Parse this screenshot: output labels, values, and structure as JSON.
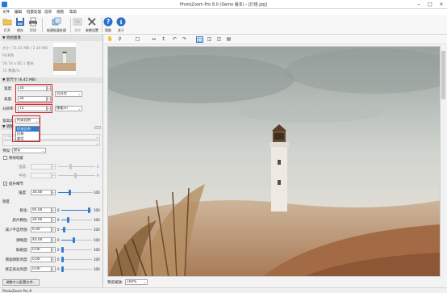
{
  "window": {
    "title": "PhotoZoom Pro 8.0 (Demo 版本) - [灯塔.jpg]"
  },
  "menu": [
    "文件",
    "编辑",
    "批量处理",
    "选项",
    "视图",
    "帮助"
  ],
  "toolbar": {
    "open": "打开",
    "save": "保存",
    "print": "打印",
    "batch": "新建批量处理",
    "preview": "预览",
    "params": "参数设置",
    "help": "帮助",
    "about": "关于"
  },
  "source": {
    "header": "原始图像",
    "size": "大小: 71.61 MB / 2.16 MB",
    "color": "RGB色",
    "dims": "56.74 x 85.1 厘米",
    "res": "72 像素/in"
  },
  "newsize": {
    "header": "新尺寸 (6.45 MB)",
    "width_label": "宽度:",
    "width_value": "30",
    "height_label": "高度:",
    "height_value": "30",
    "unit": "百分比",
    "res_label": "分辨率:",
    "res_value": "72",
    "res_unit": "像素/in",
    "fit_label": "宽高比:",
    "fit_value": "约束比例",
    "fit_options": [
      "约束比例",
      "拉伸",
      "裁切"
    ]
  },
  "adjust": {
    "header": "调整",
    "resize_method": "S-Spline Max",
    "preset_label": "预设:",
    "preset_value": "默认"
  },
  "remove": {
    "label": "移除瑕疵",
    "amount_label": "强度:",
    "amount_value": "",
    "radius_label": "半径:",
    "radius_value": ""
  },
  "enhance": {
    "label": "提升细节",
    "strength_label": "强度:",
    "strength_value": "30.00",
    "strength_max": "100",
    "group": "锐度",
    "rows": [
      {
        "label": "锐化:",
        "value": "95.00",
        "min": "0",
        "max": "100",
        "level": 0.95
      },
      {
        "label": "胶片颗粒:",
        "value": "20.00",
        "min": "0",
        "max": "100",
        "level": 0.2
      },
      {
        "label": "减少不自然感:",
        "value": "6.00",
        "min": "0",
        "max": "100",
        "level": 0.06
      },
      {
        "label": "清晰度:",
        "value": "40.00",
        "min": "0",
        "max": "100",
        "level": 0.4
      },
      {
        "label": "鲜艳度:",
        "value": "0.00",
        "min": "0",
        "max": "100",
        "level": 0.0
      },
      {
        "label": "增加阴影亮度:",
        "value": "0.00",
        "min": "0",
        "max": "100",
        "level": 0.0
      },
      {
        "label": "修正高光亮度:",
        "value": "0.00",
        "min": "0",
        "max": "100",
        "level": 0.0
      }
    ]
  },
  "bottom": {
    "batch_button": "调整大小配置文件...",
    "zoom_label": "预览缩放:",
    "zoom_value": "100%"
  },
  "status": {
    "text": "PhotoZoom Pro 8"
  },
  "colors": {
    "accent": "#2d7dd2",
    "highlight": "#e0202a"
  }
}
